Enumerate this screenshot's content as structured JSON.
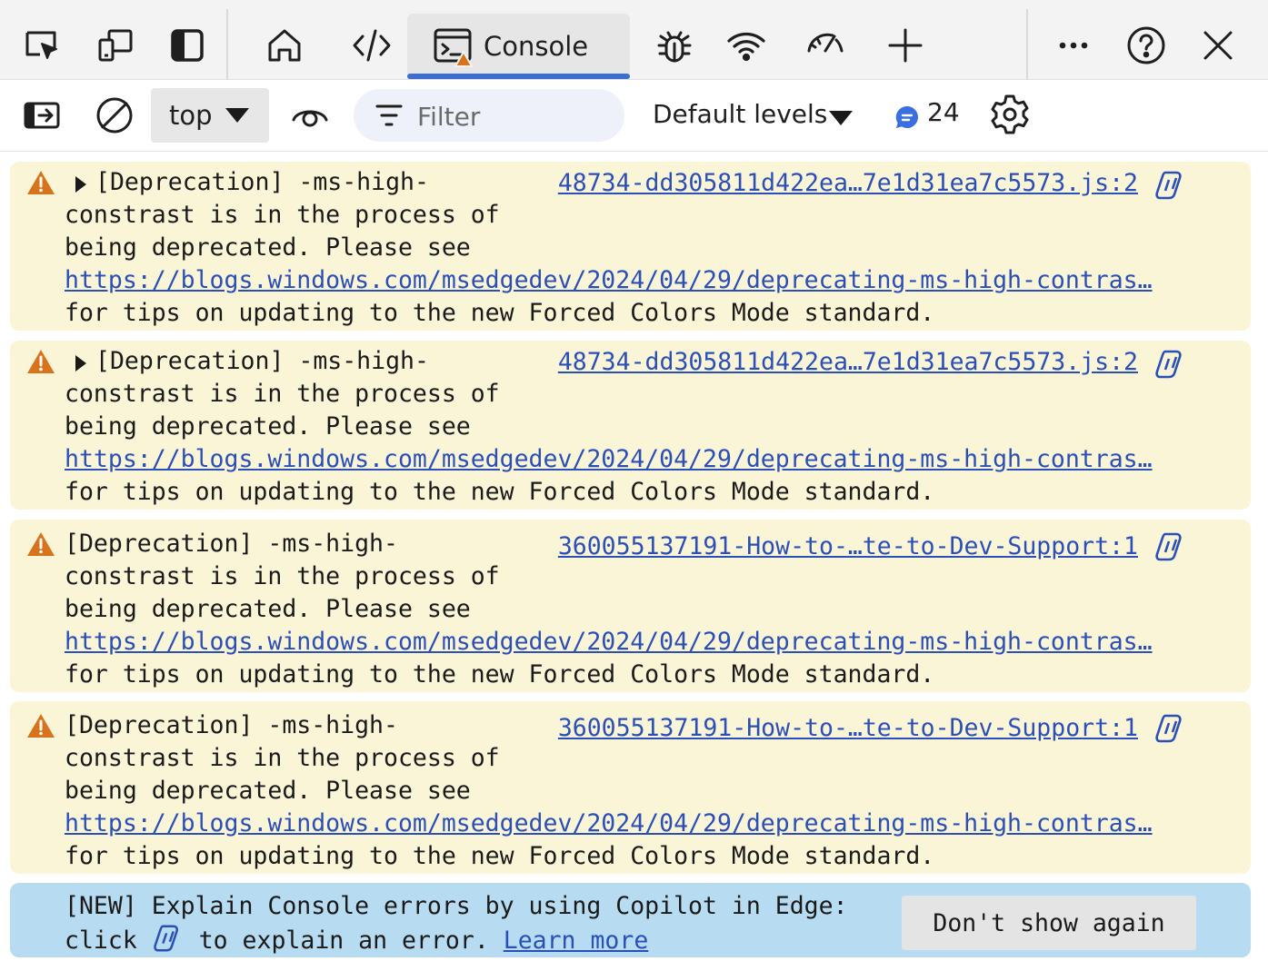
{
  "tabs": {
    "console_label": "Console"
  },
  "toolbar": {
    "context_value": "top",
    "filter_placeholder": "Filter",
    "levels_label": "Default levels",
    "message_count": "24"
  },
  "messages": [
    {
      "line1": "[Deprecation] -ms-high-",
      "line2": "constrast is in the process of",
      "line3": "being deprecated. Please see",
      "url": "https://blogs.windows.com/msedgedev/2024/04/29/deprecating-ms-high-contras…",
      "line5": "for tips on updating to the new Forced Colors Mode standard.",
      "source": "48734-dd305811d422ea…7e1d31ea7c5573.js:2",
      "expandable": true
    },
    {
      "line1": "[Deprecation] -ms-high-",
      "line2": "constrast is in the process of",
      "line3": "being deprecated. Please see",
      "url": "https://blogs.windows.com/msedgedev/2024/04/29/deprecating-ms-high-contras…",
      "line5": "for tips on updating to the new Forced Colors Mode standard.",
      "source": "48734-dd305811d422ea…7e1d31ea7c5573.js:2",
      "expandable": true
    },
    {
      "line1": "[Deprecation] -ms-high-",
      "line2": "constrast is in the process of",
      "line3": "being deprecated. Please see",
      "url": "https://blogs.windows.com/msedgedev/2024/04/29/deprecating-ms-high-contras…",
      "line5": "for tips on updating to the new Forced Colors Mode standard.",
      "source": "360055137191-How-to-…te-to-Dev-Support:1",
      "expandable": false
    },
    {
      "line1": "[Deprecation] -ms-high-",
      "line2": "constrast is in the process of",
      "line3": "being deprecated. Please see",
      "url": "https://blogs.windows.com/msedgedev/2024/04/29/deprecating-ms-high-contras…",
      "line5": "for tips on updating to the new Forced Colors Mode standard.",
      "source": "360055137191-How-to-…te-to-Dev-Support:1",
      "expandable": false
    }
  ],
  "tip": {
    "line1": "[NEW] Explain Console errors by using Copilot in Edge:",
    "line2_before": "click ",
    "line2_after": " to explain an error. ",
    "learn_more": "Learn more",
    "dismiss_label": "Don't show again"
  },
  "colors": {
    "warning_bg": "#fbf5d8",
    "tip_bg": "#b7dbf0",
    "accent": "#3b6fd4",
    "link": "#2a4fb8",
    "warning_icon": "#d9731b"
  },
  "icons": {
    "tab_bar": [
      "inspect-icon",
      "device-emulation-icon",
      "dock-icon",
      "welcome-icon",
      "elements-icon",
      "console-icon",
      "sources-icon",
      "network-icon",
      "performance-icon",
      "more-tools-icon",
      "more-icon",
      "help-icon",
      "close-icon"
    ],
    "toolbar": [
      "sidebar-icon",
      "clear-icon",
      "eye-icon",
      "filter-icon",
      "message-icon",
      "gear-icon"
    ]
  }
}
